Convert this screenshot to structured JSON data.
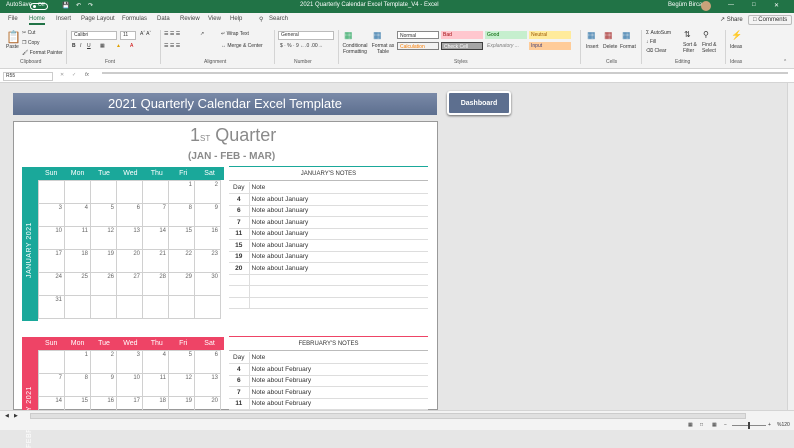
{
  "titlebar": {
    "autosave": "AutoSave",
    "autosave_state": "Off",
    "doc_title": "2021 Quarterly Calendar Excel Template_V4  -  Excel",
    "user": "Begüm Bircan"
  },
  "tabs": [
    "File",
    "Home",
    "Insert",
    "Page Layout",
    "Formulas",
    "Data",
    "Review",
    "View",
    "Help"
  ],
  "search": "Search",
  "top_buttons": {
    "share": "Share",
    "comments": "Comments"
  },
  "ribbon": {
    "clipboard": {
      "paste": "Paste",
      "cut": "Cut",
      "copy": "Copy",
      "format_painter": "Format Painter",
      "group": "Clipboard"
    },
    "font": {
      "name": "Calibri",
      "size": "11",
      "group": "Font"
    },
    "alignment": {
      "wrap": "Wrap Text",
      "merge": "Merge & Center",
      "group": "Alignment"
    },
    "number": {
      "format": "General",
      "group": "Number"
    },
    "styles": {
      "conditional": "Conditional Formatting",
      "format_table": "Format as Table",
      "normal": "Normal",
      "bad": "Bad",
      "good": "Good",
      "neutral": "Neutral",
      "calculation": "Calculation",
      "check_cell": "Check Cell",
      "explanatory": "Explanatory ...",
      "input": "Input",
      "group": "Styles"
    },
    "cells": {
      "insert": "Insert",
      "delete": "Delete",
      "format": "Format",
      "group": "Cells"
    },
    "editing": {
      "autosum": "AutoSum",
      "fill": "Fill",
      "clear": "Clear",
      "sort": "Sort & Filter",
      "find": "Find & Select",
      "group": "Editing"
    },
    "ideas": {
      "label": "Ideas",
      "group": "Ideas"
    }
  },
  "formula_bar": {
    "cell_ref": "R55",
    "fx": "fx",
    "value": ""
  },
  "sheet": {
    "banner": "2021 Quarterly Calendar Excel Template",
    "dashboard_button": "Dashboard",
    "quarter_number": "1",
    "quarter_suffix": "ST",
    "quarter_word": "Quarter",
    "quarter_months": "(JAN - FEB - MAR)",
    "weekdays": [
      "Sun",
      "Mon",
      "Tue",
      "Wed",
      "Thu",
      "Fri",
      "Sat"
    ],
    "january": {
      "label": "JANUARY 2021",
      "color": "#1aa89a",
      "weeks": [
        [
          "",
          "",
          "",
          "",
          "",
          "1",
          "2"
        ],
        [
          "3",
          "4",
          "5",
          "6",
          "7",
          "8",
          "9"
        ],
        [
          "10",
          "11",
          "12",
          "13",
          "14",
          "15",
          "16"
        ],
        [
          "17",
          "18",
          "19",
          "20",
          "21",
          "22",
          "23"
        ],
        [
          "24",
          "25",
          "26",
          "27",
          "28",
          "29",
          "30"
        ],
        [
          "31",
          "",
          "",
          "",
          "",
          "",
          ""
        ]
      ],
      "notes_title": "JANUARY'S NOTES",
      "notes_day_header": "Day",
      "notes_note_header": "Note",
      "notes": [
        [
          "4",
          "Note about January"
        ],
        [
          "6",
          "Note about January"
        ],
        [
          "7",
          "Note about January"
        ],
        [
          "11",
          "Note about January"
        ],
        [
          "15",
          "Note about January"
        ],
        [
          "19",
          "Note about January"
        ],
        [
          "20",
          "Note about January"
        ],
        [
          "",
          ""
        ],
        [
          "",
          ""
        ],
        [
          "",
          ""
        ]
      ]
    },
    "february": {
      "label": "FEBRUARY 2021",
      "color": "#ee4466",
      "weeks": [
        [
          "",
          "1",
          "2",
          "3",
          "4",
          "5",
          "6"
        ],
        [
          "7",
          "8",
          "9",
          "10",
          "11",
          "12",
          "13"
        ],
        [
          "14",
          "15",
          "16",
          "17",
          "18",
          "19",
          "20"
        ]
      ],
      "notes_title": "FEBRUARY'S NOTES",
      "notes_day_header": "Day",
      "notes_note_header": "Note",
      "notes": [
        [
          "4",
          "Note about February"
        ],
        [
          "6",
          "Note about February"
        ],
        [
          "7",
          "Note about February"
        ],
        [
          "11",
          "Note about February"
        ]
      ]
    }
  },
  "status": {
    "zoom": "%120"
  }
}
